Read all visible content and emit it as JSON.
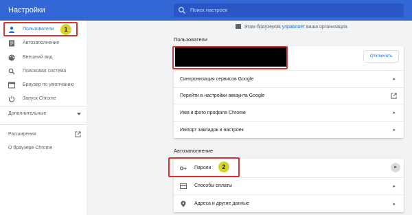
{
  "header": {
    "title": "Настройки",
    "search_placeholder": "Поиск настроек"
  },
  "sidebar": {
    "items": [
      {
        "label": "Пользователи",
        "icon": "person-icon",
        "active": true
      },
      {
        "label": "Автозаполнение",
        "icon": "autofill-icon"
      },
      {
        "label": "Внешний вид",
        "icon": "palette-icon"
      },
      {
        "label": "Поисковая система",
        "icon": "search-icon"
      },
      {
        "label": "Браузер по умолчанию",
        "icon": "browser-icon"
      },
      {
        "label": "Запуск Chrome",
        "icon": "power-icon"
      }
    ],
    "advanced_label": "Дополнительные",
    "extensions_label": "Расширения",
    "about_label": "О браузере Chrome"
  },
  "main": {
    "managed_notice": {
      "before": "Этим браузером",
      "link": "управляет",
      "after": "ваша организация."
    },
    "people_section": {
      "title": "Пользователи",
      "disable_button": "Отключить",
      "rows": [
        "Синхронизация сервисов Google",
        "Перейти в настройки аккаунта Google",
        "Имя и фото профиля Chrome",
        "Импорт закладок и настроек"
      ]
    },
    "autofill_section": {
      "title": "Автозаполнение",
      "rows": [
        {
          "label": "Пароли",
          "icon": "key-icon"
        },
        {
          "label": "Способы оплаты",
          "icon": "credit-card-icon"
        },
        {
          "label": "Адреса и другие данные",
          "icon": "location-pin-icon"
        }
      ]
    }
  },
  "annotations": {
    "badge_1": "1",
    "badge_2": "2"
  },
  "colors": {
    "header": "#3367d6",
    "accent": "#1a73e8",
    "highlight_box": "#e0312f",
    "badge": "#d6d42a"
  }
}
